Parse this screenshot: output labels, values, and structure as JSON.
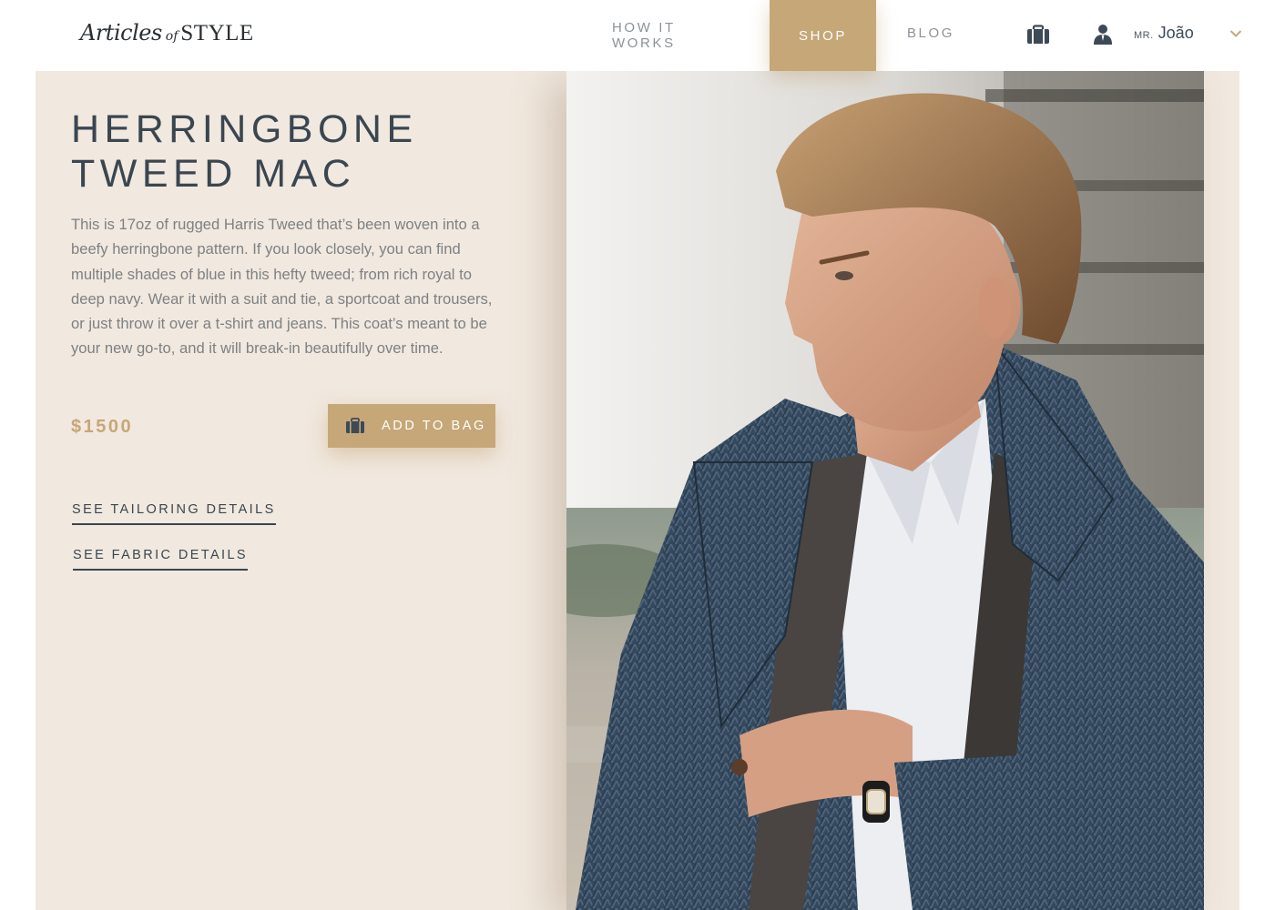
{
  "brand": {
    "script": "Articles",
    "of": "of",
    "caps": "STYLE"
  },
  "nav": {
    "items": [
      {
        "label": "HOW IT WORKS",
        "active": false
      },
      {
        "label": "SHOP",
        "active": true
      },
      {
        "label": "BLOG",
        "active": false
      }
    ],
    "bag_icon": "briefcase-icon",
    "user_icon": "user-icon",
    "user": {
      "prefix": "MR.",
      "name": "João"
    },
    "dropdown_icon": "chevron-down-icon"
  },
  "product": {
    "title_line1": "HERRINGBONE",
    "title_line2": "TWEED MAC",
    "description": "This is 17oz of rugged Harris Tweed that’s been woven into a beefy herringbone pattern. If you look closely, you can find multiple shades of blue in this hefty tweed; from rich royal to deep navy. Wear it with a suit and tie, a sportcoat and trousers, or just throw it over a t-shirt and jeans. This coat’s meant to be your new go-to, and it will break-in beautifully over time.",
    "price": "$1500",
    "add_to_bag": "ADD TO BAG",
    "links": {
      "tailoring": "SEE TAILORING DETAILS",
      "fabric": "SEE FABRIC DETAILS"
    }
  },
  "colors": {
    "accent": "#c6a778",
    "panel": "#f1e8df",
    "heading": "#3a4650",
    "body_text": "#7d8183"
  }
}
